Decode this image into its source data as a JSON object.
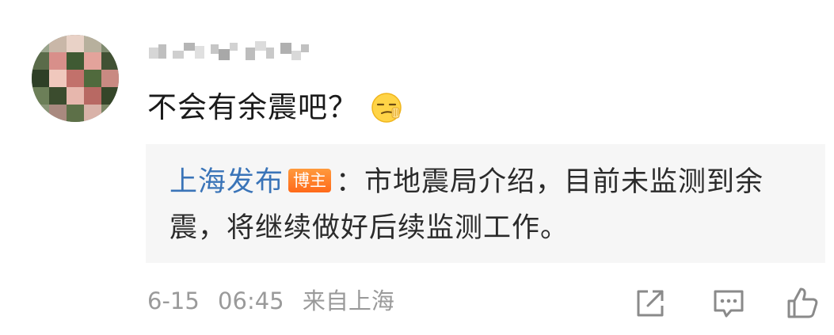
{
  "comment": {
    "text": "不会有余震吧？",
    "emoji": "smirk-emoji"
  },
  "reply": {
    "author": "上海发布",
    "badge": "博主",
    "line1_rest": "：市地震局介绍，目前未监测到余",
    "line2": "震，将继续做好后续监测工作。"
  },
  "footer": {
    "date": "6-15",
    "time": "06:45",
    "location": "来自上海"
  },
  "actions": {
    "share_icon": "share-icon",
    "comment_icon": "comment-icon",
    "like_icon": "thumbs-up-icon"
  },
  "colors": {
    "author_link": "#3a74b8",
    "badge_bg": "#ff7a22",
    "meta_text": "#9a9a9a",
    "reply_bg": "#f6f6f6",
    "icon_stroke": "#8a8a8a"
  }
}
